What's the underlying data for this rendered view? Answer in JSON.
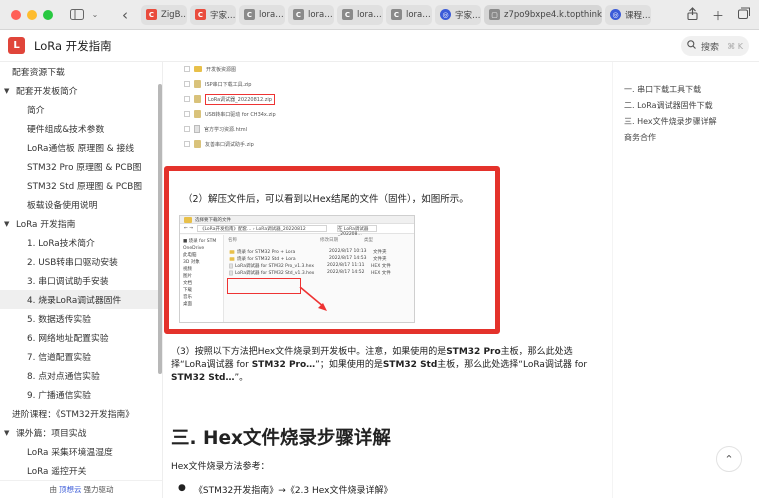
{
  "browser": {
    "tabs": [
      {
        "label": "ZigB…",
        "icon": "red",
        "glyph": "C"
      },
      {
        "label": "字家…",
        "icon": "red",
        "glyph": "C"
      },
      {
        "label": "lora…",
        "icon": "gray",
        "glyph": "C"
      },
      {
        "label": "lora…",
        "icon": "gray",
        "glyph": "C"
      },
      {
        "label": "lora…",
        "icon": "gray",
        "glyph": "C"
      },
      {
        "label": "lora…",
        "icon": "gray",
        "glyph": "C"
      },
      {
        "label": "字家…",
        "icon": "blue",
        "glyph": "◎"
      },
      {
        "label": "z7po9bxpe4.k.topthink.co",
        "icon": "gray",
        "glyph": "▢",
        "active": true
      },
      {
        "label": "课程…",
        "icon": "blue",
        "glyph": "◎"
      }
    ]
  },
  "header": {
    "logo_letter": "L",
    "title": "LoRa 开发指南",
    "search_label": "搜索",
    "search_shortcut": "⌘ K"
  },
  "sidebar": {
    "items": [
      {
        "label": "配套资源下载",
        "level": 0,
        "arrow": ""
      },
      {
        "label": "配套开发板简介",
        "level": 0,
        "arrow": "▼"
      },
      {
        "label": "简介",
        "level": 1
      },
      {
        "label": "硬件组成&技术参数",
        "level": 1
      },
      {
        "label": "LoRa通信板 原理图 & 接线",
        "level": 1
      },
      {
        "label": "STM32 Pro 原理图 & PCB图",
        "level": 1
      },
      {
        "label": "STM32 Std 原理图 & PCB图",
        "level": 1
      },
      {
        "label": "板载设备使用说明",
        "level": 1
      },
      {
        "label": "LoRa 开发指南",
        "level": 0,
        "arrow": "▼"
      },
      {
        "label": "1. LoRa技术简介",
        "level": 1
      },
      {
        "label": "2. USB转串口驱动安装",
        "level": 1
      },
      {
        "label": "3. 串口调试助手安装",
        "level": 1
      },
      {
        "label": "4. 烧录LoRa调试器固件",
        "level": 1,
        "active": true
      },
      {
        "label": "5. 数据透传实验",
        "level": 1
      },
      {
        "label": "6. 网络地址配置实验",
        "level": 1
      },
      {
        "label": "7. 信道配置实验",
        "level": 1
      },
      {
        "label": "8. 点对点通信实验",
        "level": 1
      },
      {
        "label": "9. 广播通信实验",
        "level": 1
      },
      {
        "label": "进阶课程：《STM32开发指南》",
        "level": 0,
        "arrow": ""
      },
      {
        "label": "课外篇：项目实战",
        "level": 0,
        "arrow": "▼"
      },
      {
        "label": "LoRa 采集环境温湿度",
        "level": 1
      },
      {
        "label": "LoRa 遥控开关",
        "level": 1
      }
    ],
    "footer_prefix": "由",
    "footer_brand": "顶想云",
    "footer_suffix": "强力驱动"
  },
  "content": {
    "files": [
      {
        "name": "开发板资源图",
        "type": "folder"
      },
      {
        "name": "ISP串口下载工具.zip",
        "type": "zip"
      },
      {
        "name": "LoRa调试器_20220812.zip",
        "type": "zip",
        "highlight": true
      },
      {
        "name": "USB转串口驱动 for CH34x.zip",
        "type": "zip"
      },
      {
        "name": "官方学习资源.html",
        "type": "doc"
      },
      {
        "name": "友善串口调试助手.zip",
        "type": "zip"
      }
    ],
    "callout_text": "（2）解压文件后，可以看到以Hex结尾的文件（固件），如图所示。",
    "explorer": {
      "title": "选择要下载的文件",
      "address": "《LoRa开发指南》配套… › LoRa调试器_20220812",
      "search": "在 LoRa调试器_202208…",
      "nav": [
        "■ 烧录 for STM",
        "OneDrive",
        "此电脑",
        "3D 对象",
        "视频",
        "图片",
        "文档",
        "下载",
        "音乐",
        "桌面"
      ],
      "columns": [
        "名称",
        "修改日期",
        "类型"
      ],
      "rows": [
        {
          "name": "烧录 for STM32 Pro + Lora",
          "date": "2022/8/17 10:13",
          "type": "文件夹"
        },
        {
          "name": "烧录 for STM32 Std + Lora",
          "date": "2022/8/17 14:53",
          "type": "文件夹"
        },
        {
          "name": "LoRa调试器 for STM32 Pro_v1.3.hex",
          "date": "2022/8/17 11:11",
          "type": "HEX 文件"
        },
        {
          "name": "LoRa调试器 for STM32 Std_v1.3.hex",
          "date": "2022/8/17 14:52",
          "type": "HEX 文件"
        }
      ]
    },
    "para_a": "（3）按照以下方法把Hex文件烧录到开发板中。注意，如果使用的是",
    "para_b": "STM32 Pro",
    "para_c": "主板，那么此处选择“LoRa调试器 for ",
    "para_d": "STM32 Pro…",
    "para_e": "”；如果使用的是",
    "para_f": "STM32 Std",
    "para_g": "主板，那么此处选择“LoRa调试器 for ",
    "para_h": "STM32 Std…",
    "para_i": "”。",
    "heading": "三. Hex文件烧录步骤详解",
    "method": "Hex文件烧录方法参考：",
    "bullet": "《STM32开发指南》→《2.3 Hex文件烧录详解》"
  },
  "toc": {
    "items": [
      "一. 串口下载工具下载",
      "二. LoRa调试器固件下载",
      "三. Hex文件烧录步骤详解",
      "商务合作"
    ]
  },
  "to_top": "⌃"
}
